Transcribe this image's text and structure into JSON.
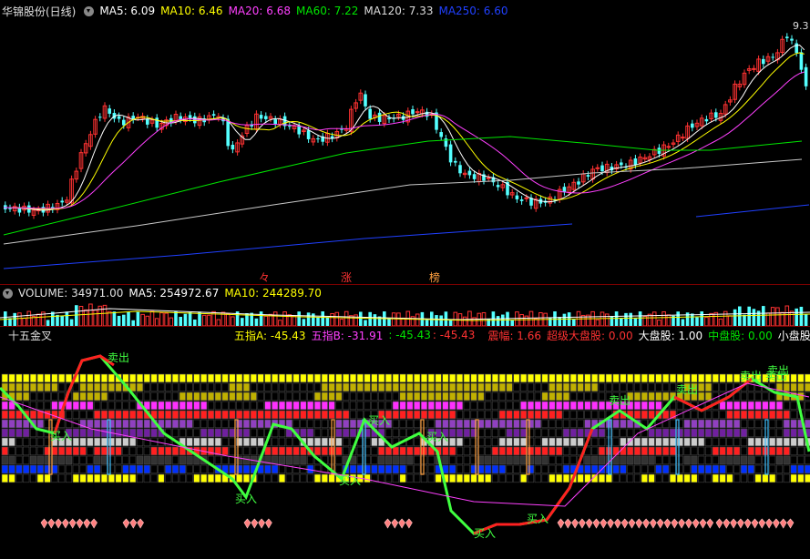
{
  "main_panel": {
    "title": "华锦股份(日线)",
    "ma5": "MA5: 6.09",
    "ma10": "MA10: 6.46",
    "ma20": "MA20: 6.68",
    "ma60": "MA60: 7.22",
    "ma120": "MA120: 7.33",
    "ma250": "MA250: 6.60",
    "price_label": "9.3",
    "tags": [
      "々",
      "涨",
      "榜"
    ]
  },
  "volume_panel": {
    "label": "VOLUME: 34971.00",
    "ma5": "MA5: 254972.67",
    "ma10": "MA10: 244289.70"
  },
  "indicator_panel": {
    "name": "十五金叉",
    "wuzhi_a": "五指A: -45.43",
    "wuzhi_b": "五指B: -31.91",
    "v1": ": -45.43",
    "v2": ": -45.43",
    "zhenfu": "震幅: 1.66",
    "chaoji": "超级大盘股: 0.00",
    "dapan": "大盘股: 1.00",
    "zhongpan": "中盘股: 0.00",
    "xiaopan": "小盘股",
    "signals": [
      {
        "text": "卖出",
        "type": "sell"
      },
      {
        "text": "买入",
        "type": "buy"
      },
      {
        "text": "卖出",
        "type": "sell"
      },
      {
        "text": "买入",
        "type": "buy"
      },
      {
        "text": "买入",
        "type": "buy"
      },
      {
        "text": "买入",
        "type": "buy"
      },
      {
        "text": "买入",
        "type": "buy"
      },
      {
        "text": "卖出",
        "type": "sell"
      },
      {
        "text": "卖出",
        "type": "sell"
      },
      {
        "text": "卖出",
        "type": "sell"
      },
      {
        "text": "买入",
        "type": "buy"
      },
      {
        "text": "买入",
        "type": "buy"
      },
      {
        "text": "卖出",
        "type": "sell"
      }
    ]
  },
  "colors": {
    "up": "#ff3232",
    "down": "#54ffff",
    "ma5": "#ffffff",
    "ma10": "#ffff00",
    "ma20": "#ff40ff",
    "ma60": "#00e600",
    "ma120": "#c8c8c8",
    "ma250": "#2040ff"
  }
}
